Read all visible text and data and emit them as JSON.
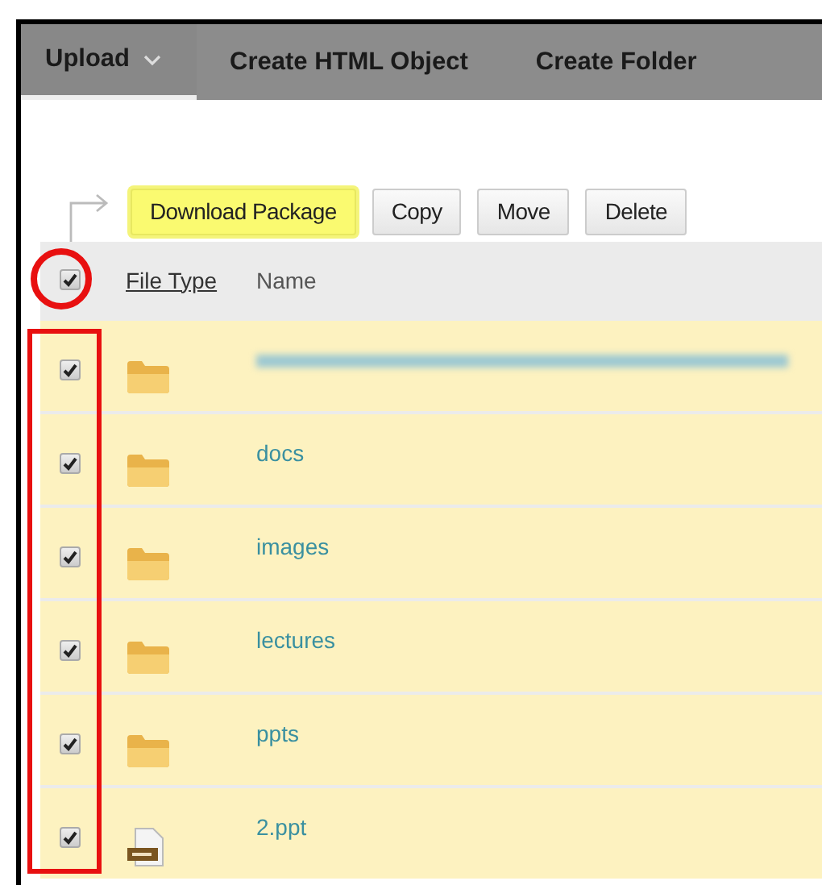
{
  "toolbar": [
    {
      "label": "Upload",
      "kind": "menu"
    },
    {
      "label": "Create HTML Object",
      "kind": "action"
    },
    {
      "label": "Create Folder",
      "kind": "action"
    }
  ],
  "actions": [
    {
      "label": "Download Package",
      "highlighted": true
    },
    {
      "label": "Copy",
      "highlighted": false
    },
    {
      "label": "Move",
      "highlighted": false
    },
    {
      "label": "Delete",
      "highlighted": false
    }
  ],
  "header": {
    "select_all": {
      "checked": true,
      "circled": true
    },
    "file_type": "File Type",
    "name": "Name"
  },
  "checkbox_column_boxed": true,
  "rows": [
    {
      "kind": "folder",
      "blurred": true,
      "checked": true
    },
    {
      "kind": "folder",
      "name": "docs",
      "checked": true
    },
    {
      "kind": "folder",
      "name": "images",
      "checked": true
    },
    {
      "kind": "folder",
      "name": "lectures",
      "checked": true
    },
    {
      "kind": "folder",
      "name": "ppts",
      "checked": true
    },
    {
      "kind": "ppt",
      "name": "2.ppt",
      "checked": true
    }
  ]
}
